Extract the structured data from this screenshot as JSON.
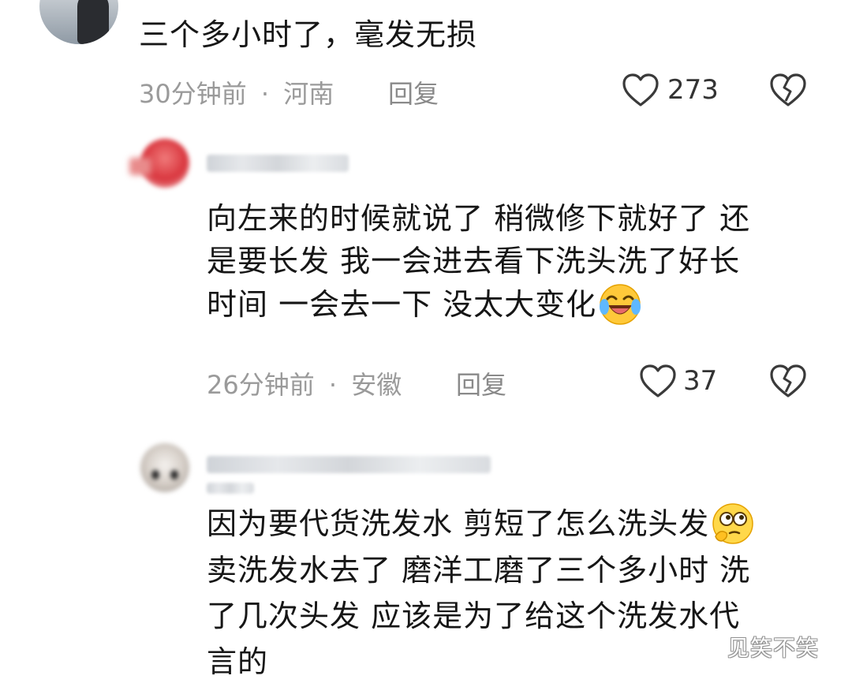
{
  "comments": [
    {
      "text": [
        "三个多小时了，毫发无损"
      ],
      "time": "30分钟前",
      "location": "河南",
      "reply_label": "回复",
      "likes": "273"
    },
    {
      "text": [
        "向左来的时候就说了 稍微修下就好了 还",
        "是要长发 我一会进去看下洗头洗了好长",
        "时间 一会去一下 没太大变化"
      ],
      "time": "26分钟前",
      "location": "安徽",
      "reply_label": "回复",
      "likes": "37"
    },
    {
      "text": [
        "因为要代货洗发水 剪短了怎么洗头发",
        "卖洗发水去了 磨洋工磨了三个多小时 洗",
        "了几次头发 应该是为了给这个洗发水代",
        "言的"
      ]
    }
  ],
  "separator": "·",
  "watermark": "见笑不笑",
  "icons": {
    "like": "heart-outline-icon",
    "dislike": "broken-heart-icon",
    "laugh_cry": "laughing-crying-emoji-icon",
    "thinking": "thinking-emoji-icon"
  },
  "colors": {
    "meta": "#9a9a9a",
    "text": "#161616"
  }
}
